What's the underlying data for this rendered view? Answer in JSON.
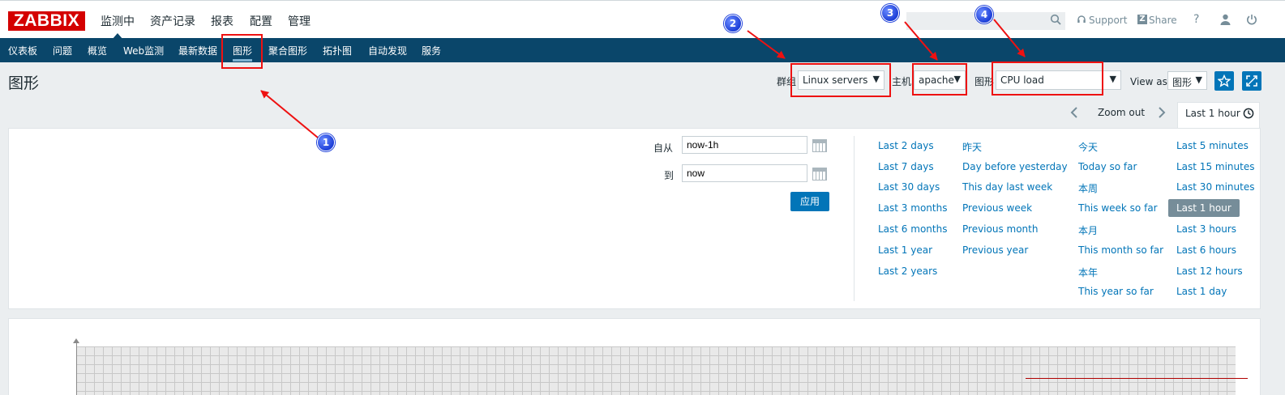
{
  "header": {
    "logo": "ZABBIX",
    "nav": [
      "监测中",
      "资产记录",
      "报表",
      "配置",
      "管理"
    ],
    "active_nav": "监测中",
    "search_value": "",
    "support_label": "Support",
    "share_label": "Share",
    "help_label": "?"
  },
  "subnav": {
    "items": [
      "仪表板",
      "问题",
      "概览",
      "Web监测",
      "最新数据",
      "图形",
      "聚合图形",
      "拓扑图",
      "自动发现",
      "服务"
    ],
    "active": "图形"
  },
  "page": {
    "title": "图形",
    "filters": {
      "group_label": "群组",
      "group_value": "Linux servers",
      "host_label": "主机",
      "host_value": "apache",
      "graph_label": "图形",
      "graph_value": "CPU load",
      "view_as_label": "View as",
      "view_as_value": "图形"
    }
  },
  "timenav": {
    "zoom_out": "Zoom out",
    "active_range": "Last 1 hour"
  },
  "timeform": {
    "from_label": "自从",
    "from_value": "now-1h",
    "to_label": "到",
    "to_value": "now",
    "apply_label": "应用"
  },
  "quick_ranges": {
    "col1": [
      "Last 2 days",
      "Last 7 days",
      "Last 30 days",
      "Last 3 months",
      "Last 6 months",
      "Last 1 year",
      "Last 2 years"
    ],
    "col2": [
      "昨天",
      "Day before yesterday",
      "This day last week",
      "Previous week",
      "Previous month",
      "Previous year"
    ],
    "col3": [
      "今天",
      "Today so far",
      "本周",
      "This week so far",
      "本月",
      "This month so far",
      "本年",
      "This year so far"
    ],
    "col4": [
      "Last 5 minutes",
      "Last 15 minutes",
      "Last 30 minutes",
      "Last 1 hour",
      "Last 3 hours",
      "Last 6 hours",
      "Last 12 hours",
      "Last 1 day"
    ],
    "selected": "Last 1 hour"
  },
  "annotations": [
    "1",
    "2",
    "3",
    "4"
  ],
  "colors": {
    "brand_red": "#d40000",
    "nav_blue": "#0a466a",
    "link_blue": "#0275b8",
    "annotation_red": "#ee1111",
    "badge_blue": "#1d3fd8"
  }
}
